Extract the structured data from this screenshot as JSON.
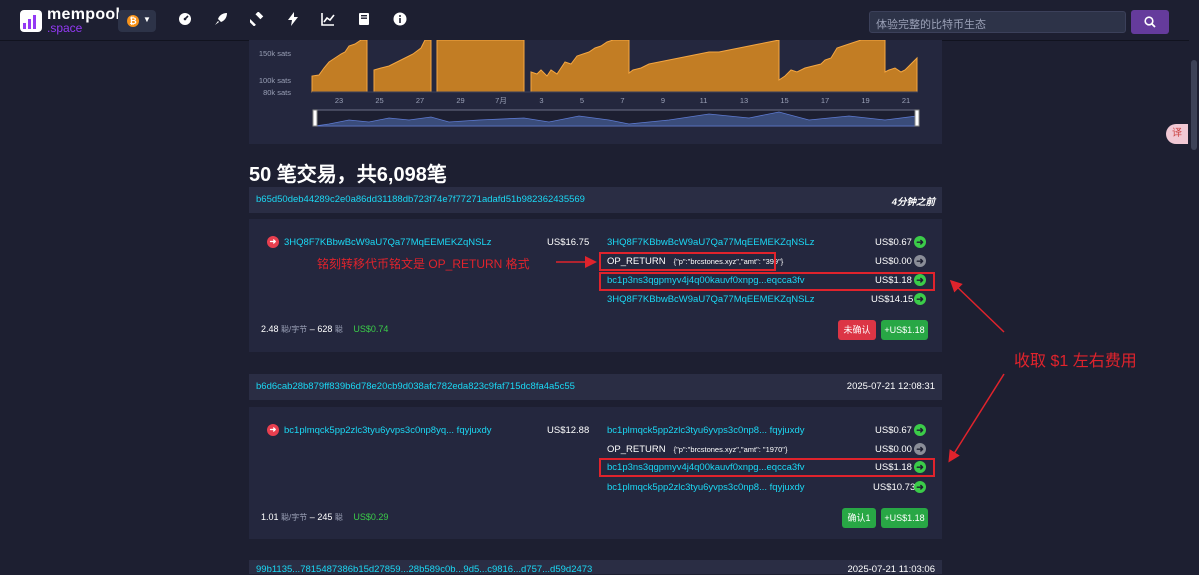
{
  "app": {
    "logo_title": "mempool",
    "logo_sub": ".space",
    "search_placeholder": "体验完整的比特币生态",
    "network_icon": "bitcoin-icon"
  },
  "nav_icons": [
    "dashboard-icon",
    "rocket-icon",
    "hammer-icon",
    "lightning-icon",
    "chart-icon",
    "book-icon",
    "info-icon"
  ],
  "chart": {
    "y_labels": [
      "150k sats",
      "100k sats",
      "80k sats"
    ],
    "x_labels": [
      "23",
      "25",
      "27",
      "29",
      "7月",
      "3",
      "5",
      "7",
      "9",
      "11",
      "13",
      "15",
      "17",
      "19",
      "21"
    ],
    "accent": "#c27d24"
  },
  "heading": "50 笔交易，共6,098笔",
  "tx1": {
    "id": "b65d50deb44289c2e0a86dd31188db723f74e7f77271adafd51b982362435569",
    "time": "4分钟之前",
    "input_addr": "3HQ8F7KBbwBcW9aU7Qa77MqEEMEKZqNSLz",
    "input_value": "US$16.75",
    "outputs": [
      {
        "addr": "3HQ8F7KBbwBcW9aU7Qa77MqEEMEKZqNSLz",
        "value": "US$0.67"
      },
      {
        "addr": "OP_RETURN",
        "json": "{\"p\":\"brcstones.xyz\",\"amt\": \"399\"}",
        "value": "US$0.00"
      },
      {
        "addr": "bc1p3ns3qgpmyv4j4q00kauvf0xnpg...eqcca3fv",
        "value": "US$1.18"
      },
      {
        "addr": "3HQ8F7KBbwBcW9aU7Qa77MqEEMEKZqNSLz",
        "value": "US$14.15"
      }
    ],
    "fee_rate": "2.48",
    "fee_rate_unit": "聪/字节",
    "fee_sep": "–",
    "fee_sats": "628",
    "fee_sats_unit": "聪",
    "fee_usd": "US$0.74",
    "status": "未确认",
    "total": "+US$1.18"
  },
  "tx2": {
    "id": "b6d6cab28b879ff839b6d78e20cb9d038afc782eda823c9faf715dc8fa4a5c55",
    "time": "2025-07-21 12:08:31",
    "input_addr": "bc1plmqck5pp2zlc3tyu6yvps3c0np8yq... fqyjuxdy",
    "input_value": "US$12.88",
    "outputs": [
      {
        "addr": "bc1plmqck5pp2zlc3tyu6yvps3c0np8... fqyjuxdy",
        "value": "US$0.67"
      },
      {
        "addr": "OP_RETURN",
        "json": "{\"p\":\"brcstones.xyz\",\"amt\": \"1970\"}",
        "value": "US$0.00"
      },
      {
        "addr": "bc1p3ns3qgpmyv4j4q00kauvf0xnpg...eqcca3fv",
        "value": "US$1.18"
      },
      {
        "addr": "bc1plmqck5pp2zlc3tyu6yvps3c0np8... fqyjuxdy",
        "value": "US$10.73"
      }
    ],
    "fee_rate": "1.01",
    "fee_rate_unit": "聪/字节",
    "fee_sep": "–",
    "fee_sats": "245",
    "fee_sats_unit": "聪",
    "fee_usd": "US$0.29",
    "status": "确认1",
    "total": "+US$1.18"
  },
  "tx3": {
    "id": "99b1135...7815487386b15d27859...28b589c0b...9d5...c9816...d757...d59d2473",
    "time": "2025-07-21 11:03:06"
  },
  "annotations": {
    "op_return_note": "铭刻转移代币铭文是 OP_RETURN 格式",
    "fee_note": "收取 $1 左右费用"
  }
}
